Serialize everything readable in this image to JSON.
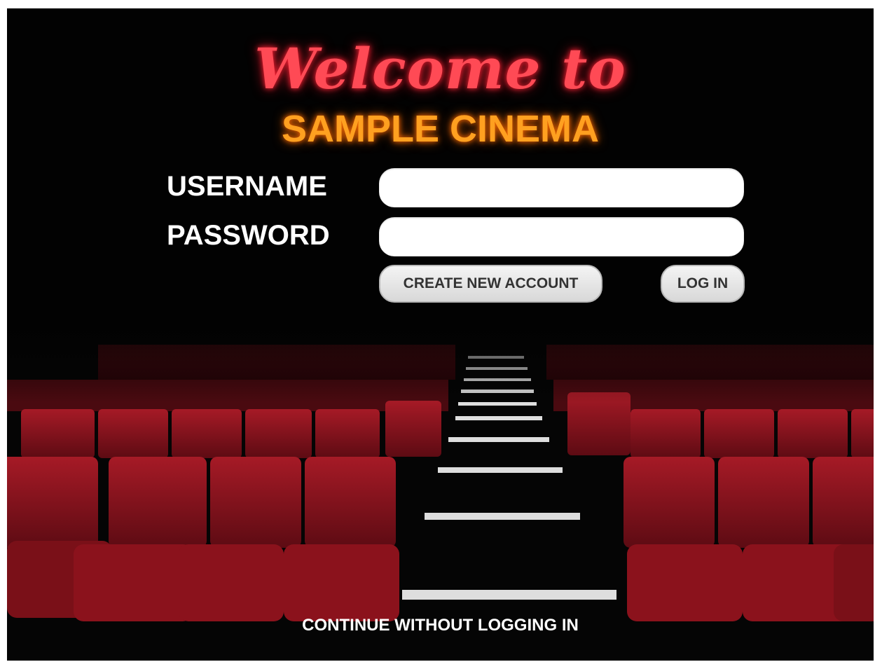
{
  "header": {
    "welcome": "Welcome to",
    "cinema_name": "SAMPLE CINEMA"
  },
  "form": {
    "username_label": "USERNAME",
    "password_label": "PASSWORD",
    "username_value": "",
    "password_value": "",
    "create_account_label": "CREATE NEW ACCOUNT",
    "login_label": "LOG IN"
  },
  "footer": {
    "continue_label": "CONTINUE WITHOUT LOGGING IN"
  },
  "colors": {
    "welcome": "#ff4a55",
    "cinema_name": "#ffa020",
    "seat": "#8e1420",
    "background": "#020202"
  }
}
